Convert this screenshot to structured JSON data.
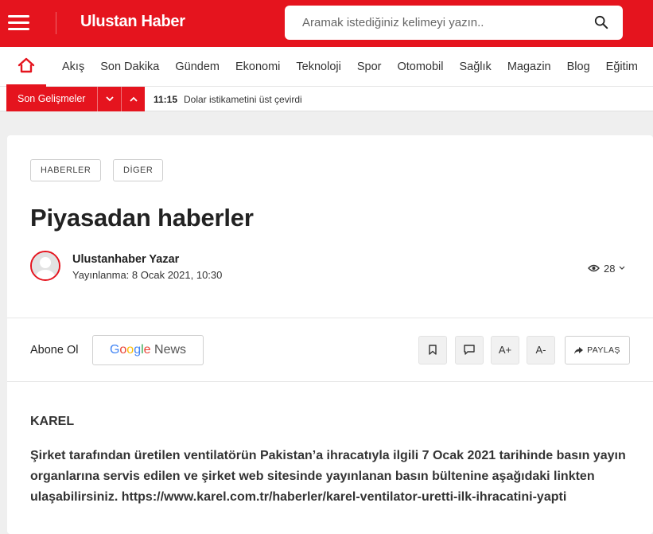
{
  "header": {
    "brand": "Ulustan Haber",
    "search_placeholder": "Aramak istediğiniz kelimeyi yazın.."
  },
  "nav": {
    "items": [
      "Akış",
      "Son Dakika",
      "Gündem",
      "Ekonomi",
      "Teknoloji",
      "Spor",
      "Otomobil",
      "Sağlık",
      "Magazin",
      "Blog",
      "Eğitim"
    ]
  },
  "breaking": {
    "label": "Son Gelişmeler",
    "time": "11:15",
    "text": "Dolar istikametini üst çevirdi"
  },
  "article": {
    "tags": [
      "HABERLER",
      "DİGER"
    ],
    "title": "Piyasadan haberler",
    "author": "Ulustanhaber Yazar",
    "published": "Yayınlanma: 8 Ocak 2021, 10:30",
    "views": "28",
    "subscribe_label": "Abone Ol",
    "google_news": {
      "g1": "G",
      "o1": "o",
      "o2": "o",
      "g2": "g",
      "l": "l",
      "e": "e",
      "news": "News"
    },
    "tools": {
      "font_increase": "A+",
      "font_decrease": "A-"
    },
    "share_label": "PAYLAŞ",
    "lead": "KAREL",
    "body_text": "Şirket tarafından üretilen ventilatörün Pakistan’a ihracatıyla ilgili 7 Ocak 2021 tarihinde basın yayın organlarına servis edilen ve şirket web sitesinde yayınlanan basın bültenine aşağıdaki linkten ulaşabilirsiniz.",
    "body_link": "https://www.karel.com.tr/haberler/karel-ventilator-uretti-ilk-ihracatini-yapti"
  },
  "colors": {
    "brand_red": "#e5141e"
  }
}
